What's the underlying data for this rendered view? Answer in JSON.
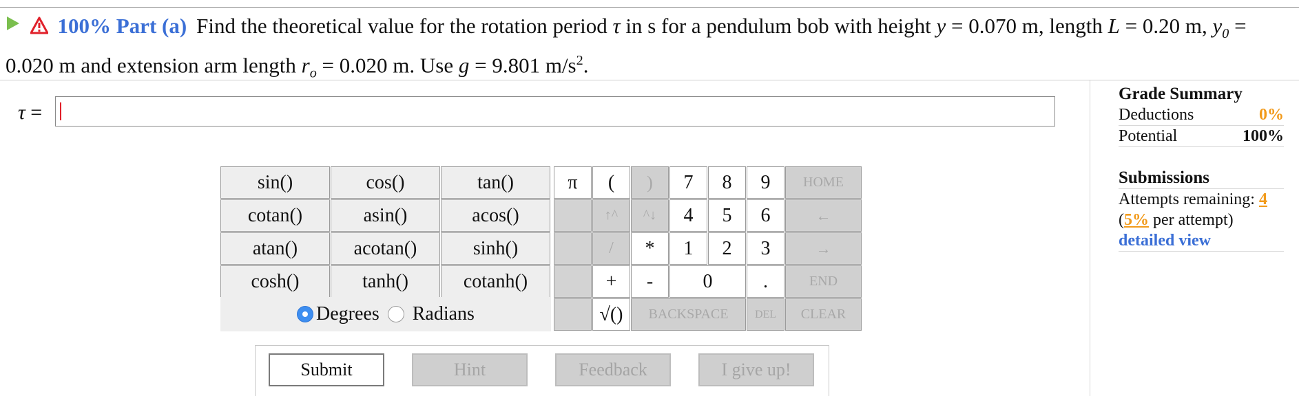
{
  "question": {
    "progress_percent": "100%",
    "part_label": "Part (a)",
    "text_line1_a": "Find the theoretical value for the rotation period ",
    "symbol_tau": "τ",
    "text_line1_b": " in s for a pendulum bob with height ",
    "var_y": "y",
    "text_eq1": " = 0.070 m, length ",
    "var_L": "L",
    "text_eq2": " = 0.20 m, ",
    "var_y0": "y",
    "sub_0": "0",
    "text_eq3": " =",
    "text_line2_a": "0.020 m and extension arm length ",
    "var_r": "r",
    "sub_o": "o",
    "text_eq4": " = 0.020 m. Use ",
    "var_g": "g",
    "text_eq5": " = 9.801 m/s",
    "sup_2": "2",
    "text_end": "."
  },
  "answer": {
    "label": "τ",
    "equals": " = ",
    "value": ""
  },
  "keypad": {
    "functions": [
      [
        "sin()",
        "cos()",
        "tan()"
      ],
      [
        "cotan()",
        "asin()",
        "acos()"
      ],
      [
        "atan()",
        "acotan()",
        "sinh()"
      ],
      [
        "cosh()",
        "tanh()",
        "cotanh()"
      ]
    ],
    "pi": "π",
    "lparen": "(",
    "rparen": ")",
    "up": "↑^",
    "down": "^↓",
    "slash": "/",
    "star": "*",
    "plus": "+",
    "minus": "-",
    "sqrt": "√()",
    "d7": "7",
    "d8": "8",
    "d9": "9",
    "d4": "4",
    "d5": "5",
    "d6": "6",
    "d1": "1",
    "d2": "2",
    "d3": "3",
    "d0": "0",
    "dot": ".",
    "home": "HOME",
    "left": "←",
    "right": "→",
    "end": "END",
    "backspace": "BACKSPACE",
    "del": "DEL",
    "clear": "CLEAR",
    "degrees": "Degrees",
    "radians": "Radians",
    "angle_mode": "Degrees"
  },
  "buttons": {
    "submit": "Submit",
    "hint": "Hint",
    "feedback": "Feedback",
    "give_up": "I give up!"
  },
  "grade_summary": {
    "title": "Grade Summary",
    "deductions_label": "Deductions",
    "deductions_value": "0%",
    "potential_label": "Potential",
    "potential_value": "100%"
  },
  "submissions": {
    "title": "Submissions",
    "attempts_label": "Attempts remaining: ",
    "attempts_value": "4",
    "per_attempt_open": "(",
    "per_attempt_value": "5%",
    "per_attempt_text": " per attempt)",
    "detailed_view": "detailed view"
  },
  "colors": {
    "accent_blue": "#3b6fd6",
    "accent_orange": "#f29a1a",
    "play_green": "#7bbf4e",
    "warn_red": "#e0202a"
  },
  "icons": [
    "play-icon",
    "warning-icon"
  ]
}
